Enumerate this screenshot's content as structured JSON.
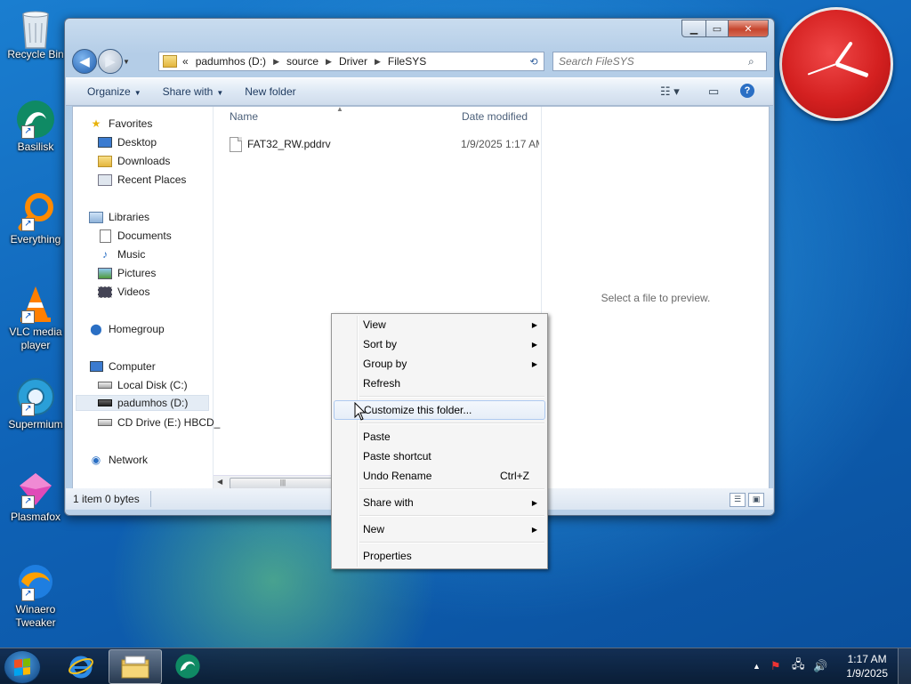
{
  "desktop": {
    "icons": [
      {
        "label": "Recycle Bin"
      },
      {
        "label": "Basilisk"
      },
      {
        "label": "Everything"
      },
      {
        "label": "VLC media player"
      },
      {
        "label": "Supermium"
      },
      {
        "label": "Plasmafox"
      },
      {
        "label": "Winaero Tweaker"
      }
    ]
  },
  "explorer": {
    "address": {
      "overflow": "«",
      "crumbs": [
        "padumhos (D:)",
        "source",
        "Driver",
        "FileSYS"
      ]
    },
    "search_placeholder": "Search FileSYS",
    "toolbar": {
      "organize": "Organize",
      "share_with": "Share with",
      "new_folder": "New folder"
    },
    "nav": {
      "favorites": "Favorites",
      "desktop": "Desktop",
      "downloads": "Downloads",
      "recent_places": "Recent Places",
      "libraries": "Libraries",
      "documents": "Documents",
      "music": "Music",
      "pictures": "Pictures",
      "videos": "Videos",
      "homegroup": "Homegroup",
      "computer": "Computer",
      "local_disk": "Local Disk (C:)",
      "padumhos": "padumhos (D:)",
      "cd_drive": "CD Drive (E:) HBCD_",
      "network": "Network"
    },
    "columns": {
      "name": "Name",
      "date_modified": "Date modified"
    },
    "files": [
      {
        "name": "FAT32_RW.pddrv",
        "date": "1/9/2025 1:17 AM"
      }
    ],
    "preview_text": "Select a file to preview.",
    "status": "1 item 0 bytes"
  },
  "context_menu": {
    "view": "View",
    "sort_by": "Sort by",
    "group_by": "Group by",
    "refresh": "Refresh",
    "customize": "Customize this folder...",
    "paste": "Paste",
    "paste_shortcut": "Paste shortcut",
    "undo_rename": "Undo Rename",
    "undo_shortcut": "Ctrl+Z",
    "share_with": "Share with",
    "new": "New",
    "properties": "Properties"
  },
  "taskbar": {
    "time": "1:17 AM",
    "date": "1/9/2025"
  }
}
